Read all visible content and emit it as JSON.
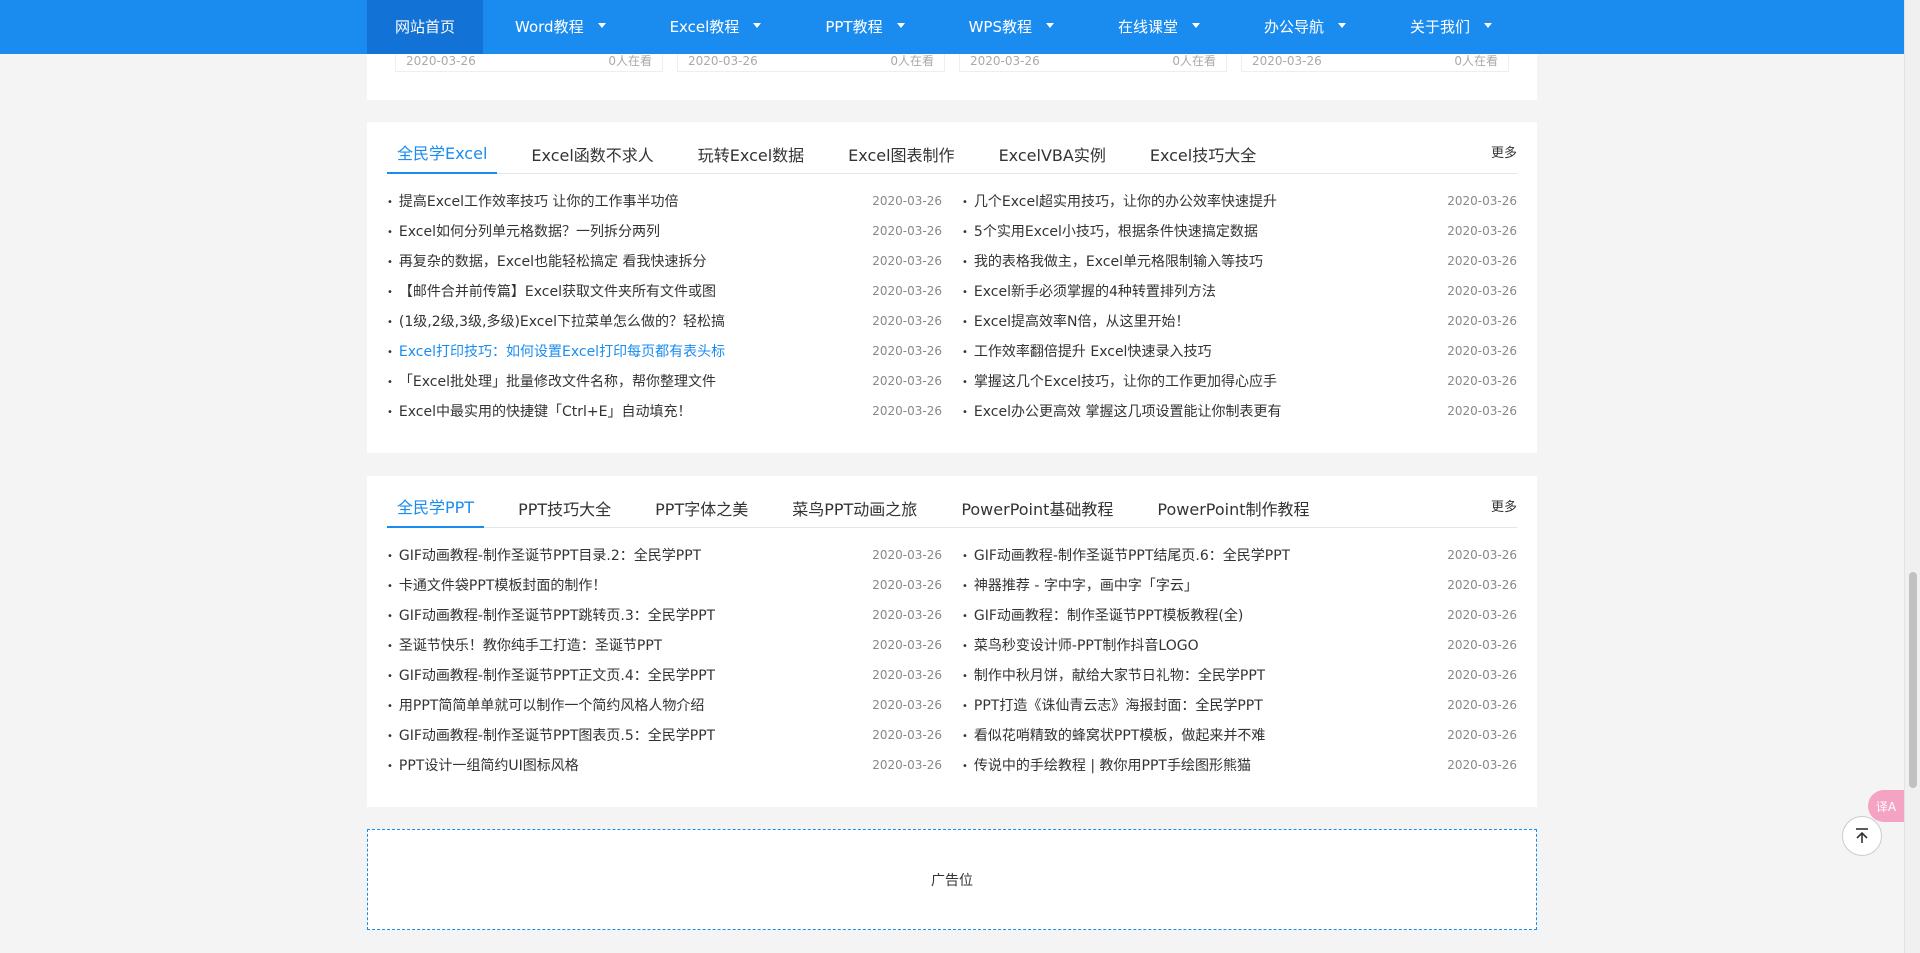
{
  "nav": {
    "items": [
      {
        "label": "网站首页",
        "active": true,
        "dropdown": false
      },
      {
        "label": "Word教程",
        "dropdown": true
      },
      {
        "label": "Excel教程",
        "dropdown": true
      },
      {
        "label": "PPT教程",
        "dropdown": true
      },
      {
        "label": "WPS教程",
        "dropdown": true
      },
      {
        "label": "在线课堂",
        "dropdown": true
      },
      {
        "label": "办公导航",
        "dropdown": true
      },
      {
        "label": "关于我们",
        "dropdown": true
      }
    ]
  },
  "prev_card": {
    "items": [
      {
        "date": "2020-03-26",
        "views": "0人在看"
      },
      {
        "date": "2020-03-26",
        "views": "0人在看"
      },
      {
        "date": "2020-03-26",
        "views": "0人在看"
      },
      {
        "date": "2020-03-26",
        "views": "0人在看"
      }
    ]
  },
  "excel_panel": {
    "tabs": [
      "全民学Excel",
      "Excel函数不求人",
      "玩转Excel数据",
      "Excel图表制作",
      "ExcelVBA实例",
      "Excel技巧大全"
    ],
    "more": "更多",
    "left": [
      {
        "title": "提高Excel工作效率技巧 让你的工作事半功倍",
        "date": "2020-03-26"
      },
      {
        "title": "Excel如何分列单元格数据？一列拆分两列",
        "date": "2020-03-26"
      },
      {
        "title": "再复杂的数据，Excel也能轻松搞定 看我快速拆分",
        "date": "2020-03-26"
      },
      {
        "title": "【邮件合并前传篇】Excel获取文件夹所有文件或图",
        "date": "2020-03-26"
      },
      {
        "title": "(1级,2级,3级,多级)Excel下拉菜单怎么做的？轻松搞",
        "date": "2020-03-26"
      },
      {
        "title": "Excel打印技巧：如何设置Excel打印每页都有表头标",
        "date": "2020-03-26",
        "highlight": true
      },
      {
        "title": "「Excel批处理」批量修改文件名称，帮你整理文件",
        "date": "2020-03-26"
      },
      {
        "title": "Excel中最实用的快捷键「Ctrl+E」自动填充！",
        "date": "2020-03-26"
      }
    ],
    "right": [
      {
        "title": "几个Excel超实用技巧，让你的办公效率快速提升",
        "date": "2020-03-26"
      },
      {
        "title": "5个实用Excel小技巧，根据条件快速搞定数据",
        "date": "2020-03-26"
      },
      {
        "title": "我的表格我做主，Excel单元格限制输入等技巧",
        "date": "2020-03-26"
      },
      {
        "title": "Excel新手必须掌握的4种转置排列方法",
        "date": "2020-03-26"
      },
      {
        "title": "Excel提高效率N倍，从这里开始！",
        "date": "2020-03-26"
      },
      {
        "title": "工作效率翻倍提升 Excel快速录入技巧",
        "date": "2020-03-26"
      },
      {
        "title": "掌握这几个Excel技巧，让你的工作更加得心应手",
        "date": "2020-03-26"
      },
      {
        "title": "Excel办公更高效 掌握这几项设置能让你制表更有",
        "date": "2020-03-26"
      }
    ]
  },
  "ppt_panel": {
    "tabs": [
      "全民学PPT",
      "PPT技巧大全",
      "PPT字体之美",
      "菜鸟PPT动画之旅",
      "PowerPoint基础教程",
      "PowerPoint制作教程"
    ],
    "more": "更多",
    "left": [
      {
        "title": "GIF动画教程-制作圣诞节PPT目录.2：全民学PPT",
        "date": "2020-03-26"
      },
      {
        "title": "卡通文件袋PPT模板封面的制作！",
        "date": "2020-03-26"
      },
      {
        "title": "GIF动画教程-制作圣诞节PPT跳转页.3：全民学PPT",
        "date": "2020-03-26"
      },
      {
        "title": "圣诞节快乐！教你纯手工打造：圣诞节PPT",
        "date": "2020-03-26"
      },
      {
        "title": "GIF动画教程-制作圣诞节PPT正文页.4：全民学PPT",
        "date": "2020-03-26"
      },
      {
        "title": "用PPT简简单单就可以制作一个简约风格人物介绍",
        "date": "2020-03-26"
      },
      {
        "title": "GIF动画教程-制作圣诞节PPT图表页.5：全民学PPT",
        "date": "2020-03-26"
      },
      {
        "title": "PPT设计一组简约UI图标风格",
        "date": "2020-03-26"
      }
    ],
    "right": [
      {
        "title": "GIF动画教程-制作圣诞节PPT结尾页.6：全民学PPT",
        "date": "2020-03-26"
      },
      {
        "title": "神器推荐 - 字中字，画中字「字云」",
        "date": "2020-03-26"
      },
      {
        "title": "GIF动画教程：制作圣诞节PPT模板教程(全)",
        "date": "2020-03-26"
      },
      {
        "title": "菜鸟秒变设计师-PPT制作抖音LOGO",
        "date": "2020-03-26"
      },
      {
        "title": "制作中秋月饼，献给大家节日礼物：全民学PPT",
        "date": "2020-03-26"
      },
      {
        "title": "PPT打造《诛仙青云志》海报封面：全民学PPT",
        "date": "2020-03-26"
      },
      {
        "title": "看似花哨精致的蜂窝状PPT模板，做起来并不难",
        "date": "2020-03-26"
      },
      {
        "title": "传说中的手绘教程 | 教你用PPT手绘图形熊猫",
        "date": "2020-03-26"
      }
    ]
  },
  "ad": {
    "label": "广告位"
  },
  "floating": {
    "translate_label": "译A",
    "totop_icon": "arrow-up-icon"
  },
  "colors": {
    "primary": "#1a8cf0",
    "nav_active": "#1272d6",
    "background": "#f4f4f4"
  }
}
